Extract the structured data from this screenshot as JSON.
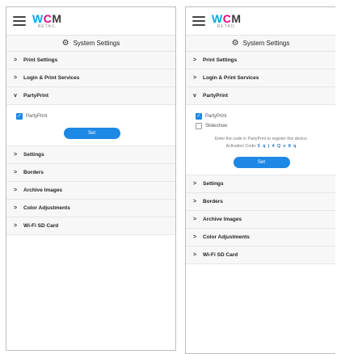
{
  "brand": {
    "logo_main": "WCM",
    "logo_sub": "RETAIL"
  },
  "title": "System Settings",
  "left": {
    "rows_top": [
      {
        "label": "Print Settings",
        "chevron": ">"
      },
      {
        "label": "Login & Print Services",
        "chevron": ">"
      },
      {
        "label": "PartyPrint",
        "chevron": "v"
      }
    ],
    "checkbox_label": "PartyPrint",
    "set_label": "Set",
    "rows_bottom": [
      {
        "label": "Settings",
        "chevron": ">"
      },
      {
        "label": "Borders",
        "chevron": ">"
      },
      {
        "label": "Archive Images",
        "chevron": ">"
      },
      {
        "label": "Color Adjustments",
        "chevron": ">"
      },
      {
        "label": "Wi-Fi SD Card",
        "chevron": ">"
      }
    ]
  },
  "right": {
    "rows_top": [
      {
        "label": "Print Settings",
        "chevron": ">"
      },
      {
        "label": "Login & Print Services",
        "chevron": ">"
      },
      {
        "label": "PartyPrint",
        "chevron": "v"
      }
    ],
    "checkbox1_label": "PartyPrint",
    "checkbox2_label": "Slideshow",
    "info_text": "Enter the code in PartyPrint to register this device.",
    "activation_label": "Activation Code:",
    "activation_code": "5 q j 4 Q v 8 q",
    "set_label": "Set",
    "rows_bottom": [
      {
        "label": "Settings",
        "chevron": ">"
      },
      {
        "label": "Borders",
        "chevron": ">"
      },
      {
        "label": "Archive Images",
        "chevron": ">"
      },
      {
        "label": "Color Adjustments",
        "chevron": ">"
      },
      {
        "label": "Wi-Fi SD Card",
        "chevron": ">"
      }
    ]
  },
  "colors": {
    "accent": "#1e88e5",
    "brand_cyan": "#00a7e1",
    "brand_magenta": "#e5007d"
  },
  "icons": {
    "menu": "hamburger-icon",
    "settings": "gear-icon",
    "collapsed": "chevron-right-icon",
    "expanded": "chevron-down-icon"
  }
}
